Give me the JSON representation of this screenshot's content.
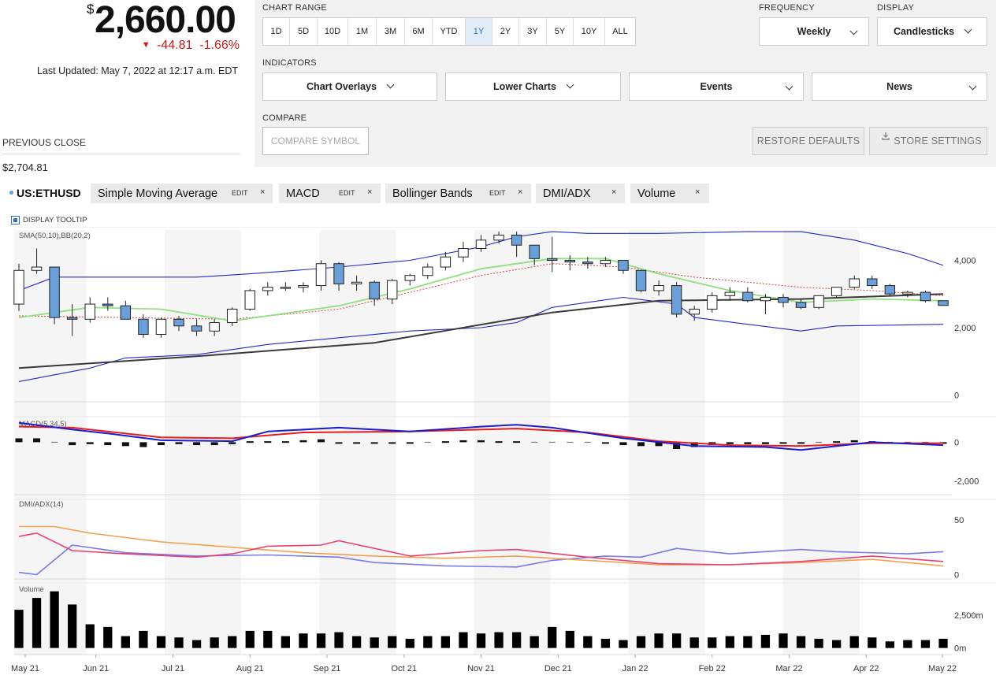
{
  "quote": {
    "currency_symbol": "$",
    "price": "2,660.00",
    "change": "-44.81",
    "change_pct": "-1.66%",
    "last_updated": "Last Updated: May 7, 2022 at 12:17 a.m. EDT",
    "previous_close_label": "PREVIOUS CLOSE",
    "previous_close": "$2,704.81",
    "down_color": "#c41a1a"
  },
  "controls": {
    "chart_range_label": "CHART RANGE",
    "ranges": [
      "1D",
      "5D",
      "10D",
      "1M",
      "3M",
      "6M",
      "YTD",
      "1Y",
      "2Y",
      "3Y",
      "5Y",
      "10Y",
      "ALL"
    ],
    "active_range": "1Y",
    "frequency_label": "FREQUENCY",
    "frequency": "Weekly",
    "display_label": "DISPLAY",
    "display": "Candlesticks",
    "indicators_label": "INDICATORS",
    "indicators": [
      "Chart Overlays",
      "Lower Charts",
      "Events",
      "News"
    ],
    "compare_label": "COMPARE",
    "compare_placeholder": "COMPARE SYMBOL",
    "restore_defaults": "RESTORE DEFAULTS",
    "store_settings": "STORE SETTINGS",
    "store_icon": "download-icon"
  },
  "legend": {
    "symbol": "US:ETHUSD",
    "edit_label": "EDIT",
    "close_label": "×",
    "tags": [
      "Simple Moving Average",
      "MACD",
      "Bollinger Bands",
      "DMI/ADX",
      "Volume"
    ],
    "display_tooltip": "DISPLAY TOOLTIP"
  },
  "chart_data": {
    "type": "candlestick",
    "frequency": "weekly",
    "x_tick_labels": [
      "May 21",
      "Jun 21",
      "Jul 21",
      "Aug 21",
      "Sep 21",
      "Oct 21",
      "Nov 21",
      "Dec 21",
      "Jan 22",
      "Feb 22",
      "Mar 22",
      "Apr 22",
      "May 22"
    ],
    "up_color": "#ffffff",
    "down_color": "#6a9fd8",
    "price_panel": {
      "label": "SMA(50,10),BB(20,2)",
      "ylim": [
        -200,
        4900
      ],
      "y_ticks": [
        0,
        2000,
        4000
      ],
      "y_tick_labels": [
        "0",
        "2,000",
        "4,000"
      ],
      "ohlc": [
        [
          2700,
          3900,
          2500,
          3700
        ],
        [
          3700,
          4350,
          3600,
          3800
        ],
        [
          3800,
          3700,
          2100,
          2300
        ],
        [
          2300,
          2700,
          1750,
          2250
        ],
        [
          2250,
          2900,
          2150,
          2700
        ],
        [
          2700,
          2900,
          2500,
          2650
        ],
        [
          2650,
          2800,
          2250,
          2250
        ],
        [
          2250,
          2400,
          1700,
          1800
        ],
        [
          1800,
          2300,
          1700,
          2250
        ],
        [
          2250,
          2350,
          1900,
          2050
        ],
        [
          2050,
          2250,
          1750,
          1900
        ],
        [
          1900,
          2250,
          1750,
          2150
        ],
        [
          2150,
          2600,
          2050,
          2550
        ],
        [
          2550,
          3150,
          2500,
          3100
        ],
        [
          3100,
          3350,
          2950,
          3200
        ],
        [
          3200,
          3350,
          3100,
          3200
        ],
        [
          3200,
          3350,
          3050,
          3250
        ],
        [
          3250,
          4000,
          3100,
          3900
        ],
        [
          3900,
          3950,
          3100,
          3300
        ],
        [
          3300,
          3550,
          3100,
          3350
        ],
        [
          3350,
          3400,
          2650,
          2850
        ],
        [
          2850,
          3450,
          2700,
          3400
        ],
        [
          3400,
          3600,
          3250,
          3550
        ],
        [
          3550,
          3900,
          3450,
          3800
        ],
        [
          3800,
          4250,
          3700,
          4100
        ],
        [
          4100,
          4550,
          3950,
          4350
        ],
        [
          4350,
          4750,
          4250,
          4600
        ],
        [
          4600,
          4850,
          4500,
          4750
        ],
        [
          4750,
          4850,
          4100,
          4450
        ],
        [
          4450,
          4450,
          3850,
          4050
        ],
        [
          4050,
          4700,
          3650,
          4000
        ],
        [
          4000,
          4150,
          3700,
          3950
        ],
        [
          3950,
          4100,
          3750,
          3900
        ],
        [
          3900,
          4100,
          3800,
          4000
        ],
        [
          4000,
          4000,
          3600,
          3700
        ],
        [
          3700,
          3700,
          3050,
          3100
        ],
        [
          3100,
          3400,
          2950,
          3250
        ],
        [
          3250,
          3350,
          2300,
          2400
        ],
        [
          2400,
          2650,
          2200,
          2550
        ],
        [
          2550,
          3050,
          2450,
          2950
        ],
        [
          2950,
          3200,
          2800,
          3050
        ],
        [
          3050,
          3200,
          2750,
          2800
        ],
        [
          2800,
          3000,
          2400,
          2900
        ],
        [
          2900,
          3000,
          2600,
          2750
        ],
        [
          2750,
          2850,
          2550,
          2600
        ],
        [
          2600,
          2950,
          2550,
          2950
        ],
        [
          2950,
          3200,
          2900,
          3200
        ],
        [
          3200,
          3550,
          3150,
          3450
        ],
        [
          3450,
          3550,
          3150,
          3250
        ],
        [
          3250,
          3300,
          2950,
          3000
        ],
        [
          3000,
          3100,
          2900,
          3050
        ],
        [
          3050,
          3100,
          2750,
          2800
        ],
        [
          2800,
          2800,
          2650,
          2660
        ]
      ],
      "sma_long_name": "SMA(50)",
      "sma_long_color": "#3a3a3a",
      "sma_long": [
        [
          0,
          800
        ],
        [
          10,
          1150
        ],
        [
          20,
          1550
        ],
        [
          30,
          2450
        ],
        [
          36,
          2800
        ],
        [
          44,
          2850
        ],
        [
          52,
          3000
        ]
      ],
      "sma_short_name": "SMA(10)",
      "sma_short_color": "#8fe07f",
      "sma_short": [
        [
          0,
          2300
        ],
        [
          4,
          2600
        ],
        [
          8,
          2550
        ],
        [
          12,
          2200
        ],
        [
          18,
          2650
        ],
        [
          22,
          3150
        ],
        [
          26,
          3750
        ],
        [
          30,
          4050
        ],
        [
          33,
          4050
        ],
        [
          36,
          3600
        ],
        [
          40,
          3100
        ],
        [
          44,
          2750
        ],
        [
          48,
          2850
        ],
        [
          52,
          2800
        ]
      ],
      "bb_color": "#2626c8",
      "bb_upper": [
        [
          0,
          3100
        ],
        [
          2,
          3500
        ],
        [
          10,
          3500
        ],
        [
          13,
          3600
        ],
        [
          18,
          3800
        ],
        [
          22,
          4000
        ],
        [
          26,
          4400
        ],
        [
          28,
          4700
        ],
        [
          30,
          4850
        ],
        [
          32,
          4800
        ],
        [
          36,
          4800
        ],
        [
          41,
          4850
        ],
        [
          44,
          4850
        ],
        [
          47,
          4600
        ],
        [
          50,
          4200
        ],
        [
          52,
          3850
        ]
      ],
      "bb_middle_color": "#d54040",
      "bb_middle": [
        [
          0,
          2350
        ],
        [
          6,
          2300
        ],
        [
          12,
          2250
        ],
        [
          18,
          2550
        ],
        [
          22,
          3050
        ],
        [
          26,
          3550
        ],
        [
          30,
          3900
        ],
        [
          34,
          3800
        ],
        [
          38,
          3500
        ],
        [
          44,
          3200
        ],
        [
          48,
          3100
        ],
        [
          52,
          2950
        ]
      ],
      "bb_lower": [
        [
          0,
          400
        ],
        [
          4,
          800
        ],
        [
          6,
          1100
        ],
        [
          10,
          1200
        ],
        [
          14,
          1500
        ],
        [
          18,
          1700
        ],
        [
          22,
          1900
        ],
        [
          26,
          2000
        ],
        [
          28,
          2150
        ],
        [
          30,
          2600
        ],
        [
          34,
          2900
        ],
        [
          37,
          2700
        ],
        [
          38,
          2300
        ],
        [
          41,
          2100
        ],
        [
          44,
          1900
        ],
        [
          46,
          2050
        ],
        [
          52,
          2100
        ]
      ]
    },
    "macd_panel": {
      "label": "MACD(5,34,5)",
      "ylim": [
        -2700,
        1150
      ],
      "y_ticks": [
        0,
        -2000
      ],
      "y_tick_labels": [
        "0",
        "-2,000"
      ],
      "macd_color": "#1b1bd0",
      "macd": [
        [
          0,
          1000
        ],
        [
          3,
          650
        ],
        [
          5,
          450
        ],
        [
          8,
          100
        ],
        [
          12,
          50
        ],
        [
          14,
          550
        ],
        [
          18,
          750
        ],
        [
          22,
          550
        ],
        [
          26,
          800
        ],
        [
          28,
          900
        ],
        [
          30,
          750
        ],
        [
          34,
          200
        ],
        [
          38,
          -200
        ],
        [
          42,
          -250
        ],
        [
          44,
          -400
        ],
        [
          48,
          0
        ],
        [
          52,
          -150
        ]
      ],
      "signal_color": "#e81c1c",
      "signal": [
        [
          0,
          800
        ],
        [
          3,
          750
        ],
        [
          8,
          250
        ],
        [
          12,
          200
        ],
        [
          16,
          500
        ],
        [
          22,
          550
        ],
        [
          28,
          700
        ],
        [
          32,
          500
        ],
        [
          36,
          50
        ],
        [
          40,
          -150
        ],
        [
          44,
          -200
        ],
        [
          48,
          -50
        ],
        [
          52,
          -50
        ]
      ],
      "histogram": [
        200,
        200,
        0,
        -150,
        -100,
        -150,
        -200,
        -250,
        -150,
        -100,
        -150,
        -150,
        -100,
        50,
        50,
        50,
        100,
        150,
        -50,
        -50,
        -50,
        -50,
        -50,
        0,
        50,
        100,
        100,
        50,
        50,
        0,
        0,
        0,
        0,
        -50,
        -150,
        -200,
        -200,
        -350,
        -250,
        -150,
        -100,
        -100,
        -100,
        -50,
        -50,
        0,
        50,
        100,
        50,
        0,
        0,
        0,
        -50
      ]
    },
    "dmi_panel": {
      "label": "DMI/ADX(14)",
      "ylim": [
        -4,
        66
      ],
      "y_ticks": [
        0,
        50
      ],
      "y_tick_labels": [
        "0",
        "50"
      ],
      "adx_color": "#f4a050",
      "adx": [
        [
          0,
          44
        ],
        [
          2,
          44
        ],
        [
          4,
          38
        ],
        [
          8,
          30
        ],
        [
          12,
          25
        ],
        [
          16,
          20
        ],
        [
          20,
          17
        ],
        [
          24,
          15
        ],
        [
          28,
          17
        ],
        [
          32,
          13
        ],
        [
          36,
          9
        ],
        [
          40,
          9
        ],
        [
          44,
          11
        ],
        [
          48,
          14
        ],
        [
          52,
          8
        ]
      ],
      "di_plus_color": "#e84070",
      "di_plus": [
        [
          0,
          35
        ],
        [
          1,
          38
        ],
        [
          3,
          22
        ],
        [
          6,
          19
        ],
        [
          10,
          16
        ],
        [
          12,
          19
        ],
        [
          14,
          26
        ],
        [
          17,
          27
        ],
        [
          18,
          31
        ],
        [
          22,
          17
        ],
        [
          26,
          22
        ],
        [
          28,
          23
        ],
        [
          32,
          16
        ],
        [
          36,
          10
        ],
        [
          40,
          9
        ],
        [
          44,
          12
        ],
        [
          48,
          17
        ],
        [
          52,
          12
        ]
      ],
      "di_minus_color": "#7a7ae8",
      "di_minus": [
        [
          0,
          2
        ],
        [
          1,
          0
        ],
        [
          3,
          27
        ],
        [
          6,
          20
        ],
        [
          10,
          17
        ],
        [
          14,
          18
        ],
        [
          18,
          16
        ],
        [
          20,
          11
        ],
        [
          24,
          8
        ],
        [
          28,
          7
        ],
        [
          30,
          13
        ],
        [
          33,
          17
        ],
        [
          35,
          16
        ],
        [
          37,
          24
        ],
        [
          40,
          19
        ],
        [
          44,
          23
        ],
        [
          46,
          21
        ],
        [
          50,
          19
        ],
        [
          52,
          21
        ]
      ]
    },
    "volume_panel": {
      "label": "Volume",
      "ylim": [
        -500,
        4700
      ],
      "y_ticks": [
        0,
        2500
      ],
      "y_tick_labels": [
        "0m",
        "2,500m"
      ],
      "bar_color": "#000000",
      "values": [
        2900,
        3800,
        4300,
        3300,
        1800,
        1600,
        900,
        1300,
        900,
        800,
        600,
        800,
        900,
        1300,
        1300,
        900,
        1100,
        1100,
        1200,
        900,
        800,
        900,
        700,
        900,
        900,
        1200,
        1100,
        1200,
        1200,
        900,
        1600,
        1300,
        900,
        700,
        600,
        900,
        1100,
        1100,
        800,
        800,
        900,
        900,
        1000,
        1100,
        900,
        700,
        600,
        900,
        800,
        500,
        600,
        600,
        700
      ]
    }
  }
}
